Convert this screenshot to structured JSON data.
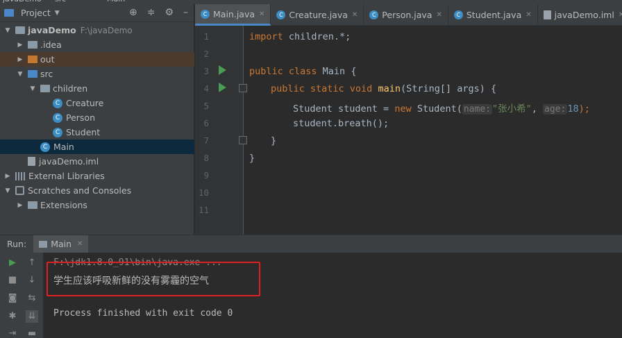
{
  "breadcrumb": [
    "javaDemo",
    "src",
    "Main"
  ],
  "project_panel": {
    "title": "Project",
    "tree": [
      {
        "label": "javaDemo",
        "note": "F:\\javaDemo",
        "level": 0,
        "expanded": true,
        "icon": "folder-grey",
        "bold": true
      },
      {
        "label": ".idea",
        "level": 1,
        "expanded": false,
        "icon": "folder-grey"
      },
      {
        "label": "out",
        "level": 1,
        "expanded": false,
        "icon": "folder-orange"
      },
      {
        "label": "src",
        "level": 1,
        "expanded": true,
        "icon": "folder-blue"
      },
      {
        "label": "children",
        "level": 2,
        "expanded": true,
        "icon": "package"
      },
      {
        "label": "Creature",
        "level": 3,
        "icon": "class"
      },
      {
        "label": "Person",
        "level": 3,
        "icon": "class"
      },
      {
        "label": "Student",
        "level": 3,
        "icon": "class"
      },
      {
        "label": "Main",
        "level": 2,
        "icon": "class",
        "selected": true
      },
      {
        "label": "javaDemo.iml",
        "level": 1,
        "icon": "file"
      },
      {
        "label": "External Libraries",
        "level": 0,
        "expanded": false,
        "icon": "library"
      },
      {
        "label": "Scratches and Consoles",
        "level": 0,
        "expanded": true,
        "icon": "scratch"
      },
      {
        "label": "Extensions",
        "level": 1,
        "expanded": false,
        "icon": "folder-grey"
      }
    ]
  },
  "editor_tabs": [
    {
      "label": "Main.java",
      "icon": "class",
      "active": true
    },
    {
      "label": "Creature.java",
      "icon": "class"
    },
    {
      "label": "Person.java",
      "icon": "class"
    },
    {
      "label": "Student.java",
      "icon": "class"
    },
    {
      "label": "javaDemo.iml",
      "icon": "file"
    }
  ],
  "editor": {
    "line_numbers": [
      "1",
      "2",
      "3",
      "4",
      "5",
      "6",
      "7",
      "8",
      "9",
      "10",
      "11"
    ],
    "code": {
      "l1_kw": "import",
      "l1_rest": " children.*;",
      "l3_kw": "public class",
      "l3_rest": " Main {",
      "l4_kw": "public static void",
      "l4_fn": "main",
      "l4_rest": "(String[] args) {",
      "l5_a": "Student student = ",
      "l5_new": "new",
      "l5_b": " Student(",
      "l5_hint1": "name:",
      "l5_str": "\"张小希\"",
      "l5_comma": ", ",
      "l5_hint2": "age:",
      "l5_num": "18",
      "l5_end": ");",
      "l6": "student.breath();",
      "l7": "}",
      "l8": "}"
    }
  },
  "run_window": {
    "label": "Run:",
    "tab": "Main",
    "console": {
      "command": "F:\\jdk1.8.0_91\\bin\\java.exe ...",
      "output": "学生应该呼吸新鲜的没有雾霾的空气",
      "exit": "Process finished with exit code 0"
    }
  },
  "colors": {
    "keyword": "#cc7832",
    "string": "#6a8759",
    "number": "#6897bb",
    "run": "#499c54",
    "annotation_box": "#e02020"
  }
}
